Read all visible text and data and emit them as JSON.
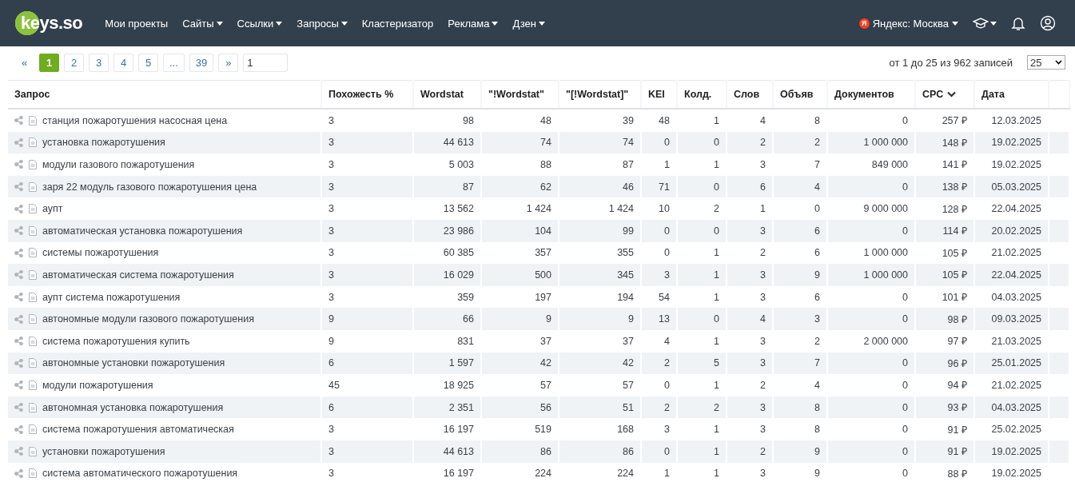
{
  "header": {
    "logo": "keys.so",
    "nav": [
      {
        "label": "Мои проекты",
        "dropdown": false
      },
      {
        "label": "Сайты",
        "dropdown": true
      },
      {
        "label": "Ссылки",
        "dropdown": true
      },
      {
        "label": "Запросы",
        "dropdown": true
      },
      {
        "label": "Кластеризатор",
        "dropdown": false
      },
      {
        "label": "Реклама",
        "dropdown": true
      },
      {
        "label": "Дзен",
        "dropdown": true
      }
    ],
    "region": {
      "badge": "Я",
      "label": "Яндекс: Москва"
    }
  },
  "pagination": {
    "prev": "«",
    "pages": [
      {
        "label": "1",
        "selected": true
      },
      {
        "label": "2",
        "selected": false
      },
      {
        "label": "3",
        "selected": false
      },
      {
        "label": "4",
        "selected": false
      },
      {
        "label": "5",
        "selected": false
      },
      {
        "label": "...",
        "selected": false
      },
      {
        "label": "39",
        "selected": false
      }
    ],
    "next": "»",
    "page_input": "1"
  },
  "summary": "от 1 до 25 из 962 записей",
  "page_size": "25",
  "table": {
    "columns": [
      {
        "label": "Запрос",
        "sorted": false
      },
      {
        "label": "Похожесть %",
        "sorted": false
      },
      {
        "label": "Wordstat",
        "sorted": false
      },
      {
        "label": "\"!Wordstat\"",
        "sorted": false
      },
      {
        "label": "\"[!Wordstat]\"",
        "sorted": false
      },
      {
        "label": "KEI",
        "sorted": false
      },
      {
        "label": "Колд.",
        "sorted": false
      },
      {
        "label": "Слов",
        "sorted": false
      },
      {
        "label": "Объяв",
        "sorted": false
      },
      {
        "label": "Документов",
        "sorted": false
      },
      {
        "label": "CPC",
        "sorted": true
      },
      {
        "label": "Дата",
        "sorted": false
      }
    ],
    "rows": [
      {
        "cells": [
          "станция пожаротушения насосная цена",
          "3",
          "98",
          "48",
          "39",
          "48",
          "1",
          "4",
          "8",
          "0",
          "257 ₽",
          "12.03.2025"
        ]
      },
      {
        "cells": [
          "установка пожаротушения",
          "3",
          "44 613",
          "74",
          "74",
          "0",
          "0",
          "2",
          "2",
          "1 000 000",
          "148 ₽",
          "19.02.2025"
        ]
      },
      {
        "cells": [
          "модули газового пожаротушения",
          "3",
          "5 003",
          "88",
          "87",
          "1",
          "1",
          "3",
          "7",
          "849 000",
          "141 ₽",
          "19.02.2025"
        ]
      },
      {
        "cells": [
          "заря 22 модуль газового пожаротушения цена",
          "3",
          "87",
          "62",
          "46",
          "71",
          "0",
          "6",
          "4",
          "0",
          "138 ₽",
          "05.03.2025"
        ]
      },
      {
        "cells": [
          "аупт",
          "3",
          "13 562",
          "1 424",
          "1 424",
          "10",
          "2",
          "1",
          "0",
          "9 000 000",
          "128 ₽",
          "22.04.2025"
        ]
      },
      {
        "cells": [
          "автоматическая установка пожаротушения",
          "3",
          "23 986",
          "104",
          "99",
          "0",
          "0",
          "3",
          "6",
          "0",
          "114 ₽",
          "20.02.2025"
        ]
      },
      {
        "cells": [
          "системы пожаротушения",
          "3",
          "60 385",
          "357",
          "355",
          "0",
          "1",
          "2",
          "6",
          "1 000 000",
          "105 ₽",
          "21.02.2025"
        ]
      },
      {
        "cells": [
          "автоматическая система пожаротушения",
          "3",
          "16 029",
          "500",
          "345",
          "3",
          "1",
          "3",
          "9",
          "1 000 000",
          "105 ₽",
          "22.04.2025"
        ]
      },
      {
        "cells": [
          "аупт система пожаротушения",
          "3",
          "359",
          "197",
          "194",
          "54",
          "1",
          "3",
          "6",
          "0",
          "101 ₽",
          "04.03.2025"
        ]
      },
      {
        "cells": [
          "автономные модули газового пожаротушения",
          "9",
          "66",
          "9",
          "9",
          "13",
          "0",
          "4",
          "3",
          "0",
          "98 ₽",
          "09.03.2025"
        ]
      },
      {
        "cells": [
          "система пожаротушения купить",
          "9",
          "831",
          "37",
          "37",
          "4",
          "1",
          "3",
          "2",
          "2 000 000",
          "97 ₽",
          "21.03.2025"
        ]
      },
      {
        "cells": [
          "автономные установки пожаротушения",
          "6",
          "1 597",
          "42",
          "42",
          "2",
          "5",
          "3",
          "7",
          "0",
          "96 ₽",
          "25.01.2025"
        ]
      },
      {
        "cells": [
          "модули пожаротушения",
          "45",
          "18 925",
          "57",
          "57",
          "0",
          "1",
          "2",
          "4",
          "0",
          "94 ₽",
          "21.02.2025"
        ]
      },
      {
        "cells": [
          "автономная установка пожаротушения",
          "6",
          "2 351",
          "56",
          "51",
          "2",
          "2",
          "3",
          "8",
          "0",
          "93 ₽",
          "04.03.2025"
        ]
      },
      {
        "cells": [
          "система пожаротушения автоматическая",
          "3",
          "16 197",
          "519",
          "168",
          "3",
          "1",
          "3",
          "8",
          "0",
          "91 ₽",
          "25.02.2025"
        ]
      },
      {
        "cells": [
          "установки пожаротушения",
          "3",
          "44 613",
          "86",
          "86",
          "0",
          "1",
          "2",
          "9",
          "0",
          "91 ₽",
          "19.02.2025"
        ]
      },
      {
        "cells": [
          "система автоматического пожаротушения",
          "3",
          "16 197",
          "224",
          "224",
          "1",
          "1",
          "3",
          "9",
          "0",
          "88 ₽",
          "19.02.2025"
        ]
      }
    ]
  }
}
